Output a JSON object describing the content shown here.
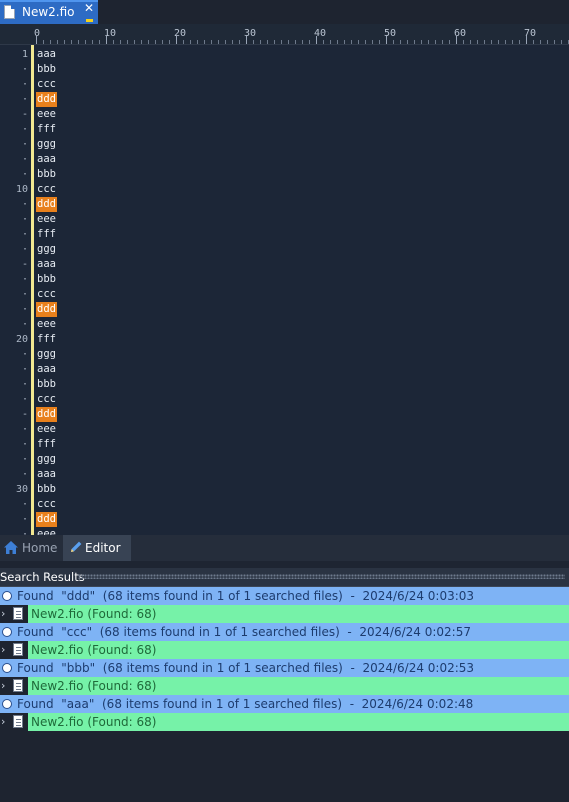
{
  "tab": {
    "filename": "New2.fio",
    "close_glyph": "✕"
  },
  "ruler": {
    "labels": [
      "0",
      "10",
      "20",
      "30",
      "40",
      "50",
      "60",
      "70"
    ]
  },
  "editor": {
    "highlight_color": "#e8801c",
    "lines": [
      {
        "num": "1",
        "text": "aaa",
        "hl": false
      },
      {
        "num": "·",
        "text": "bbb",
        "hl": false
      },
      {
        "num": "·",
        "text": "ccc",
        "hl": false
      },
      {
        "num": "·",
        "text": "ddd",
        "hl": true
      },
      {
        "num": "-",
        "text": "eee",
        "hl": false
      },
      {
        "num": "·",
        "text": "fff",
        "hl": false
      },
      {
        "num": "·",
        "text": "ggg",
        "hl": false
      },
      {
        "num": "·",
        "text": "aaa",
        "hl": false
      },
      {
        "num": "·",
        "text": "bbb",
        "hl": false
      },
      {
        "num": "10",
        "text": "ccc",
        "hl": false
      },
      {
        "num": "·",
        "text": "ddd",
        "hl": true
      },
      {
        "num": "·",
        "text": "eee",
        "hl": false
      },
      {
        "num": "·",
        "text": "fff",
        "hl": false
      },
      {
        "num": "·",
        "text": "ggg",
        "hl": false
      },
      {
        "num": "-",
        "text": "aaa",
        "hl": false
      },
      {
        "num": "·",
        "text": "bbb",
        "hl": false
      },
      {
        "num": "·",
        "text": "ccc",
        "hl": false
      },
      {
        "num": "·",
        "text": "ddd",
        "hl": true
      },
      {
        "num": "·",
        "text": "eee",
        "hl": false
      },
      {
        "num": "20",
        "text": "fff",
        "hl": false
      },
      {
        "num": "·",
        "text": "ggg",
        "hl": false
      },
      {
        "num": "·",
        "text": "aaa",
        "hl": false
      },
      {
        "num": "·",
        "text": "bbb",
        "hl": false
      },
      {
        "num": "·",
        "text": "ccc",
        "hl": false
      },
      {
        "num": "-",
        "text": "ddd",
        "hl": true
      },
      {
        "num": "·",
        "text": "eee",
        "hl": false
      },
      {
        "num": "·",
        "text": "fff",
        "hl": false
      },
      {
        "num": "·",
        "text": "ggg",
        "hl": false
      },
      {
        "num": "·",
        "text": "aaa",
        "hl": false
      },
      {
        "num": "30",
        "text": "bbb",
        "hl": false
      },
      {
        "num": "·",
        "text": "ccc",
        "hl": false
      },
      {
        "num": "·",
        "text": "ddd",
        "hl": true
      },
      {
        "num": "·",
        "text": "eee",
        "hl": false
      }
    ]
  },
  "bottom_tabs": {
    "home": "Home",
    "editor": "Editor"
  },
  "search_results": {
    "title": "Search Results",
    "entries": [
      {
        "summary": "Found  \"ddd\"  (68 items found in 1 of 1 searched files)  -  2024/6/24 0:03:03",
        "file": "New2.fio (Found: 68)"
      },
      {
        "summary": "Found  \"ccc\"  (68 items found in 1 of 1 searched files)  -  2024/6/24 0:02:57",
        "file": "New2.fio (Found: 68)"
      },
      {
        "summary": "Found  \"bbb\"  (68 items found in 1 of 1 searched files)  -  2024/6/24 0:02:53",
        "file": "New2.fio (Found: 68)"
      },
      {
        "summary": "Found  \"aaa\"  (68 items found in 1 of 1 searched files)  -  2024/6/24 0:02:48",
        "file": "New2.fio (Found: 68)"
      }
    ]
  }
}
